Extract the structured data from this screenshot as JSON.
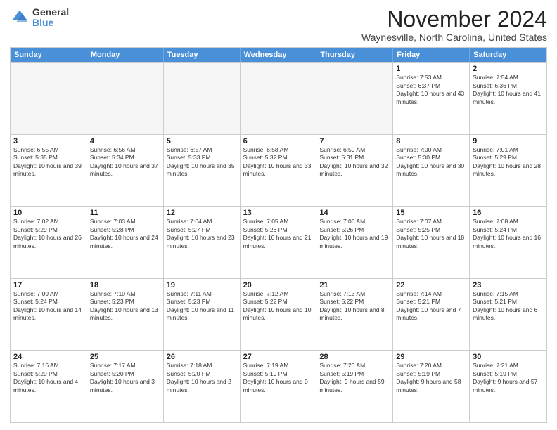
{
  "logo": {
    "general": "General",
    "blue": "Blue"
  },
  "header": {
    "month": "November 2024",
    "location": "Waynesville, North Carolina, United States"
  },
  "days": [
    "Sunday",
    "Monday",
    "Tuesday",
    "Wednesday",
    "Thursday",
    "Friday",
    "Saturday"
  ],
  "rows": [
    [
      {
        "day": "",
        "empty": true
      },
      {
        "day": "",
        "empty": true
      },
      {
        "day": "",
        "empty": true
      },
      {
        "day": "",
        "empty": true
      },
      {
        "day": "",
        "empty": true
      },
      {
        "day": "1",
        "rise": "Sunrise: 7:53 AM",
        "set": "Sunset: 6:37 PM",
        "daylight": "Daylight: 10 hours and 43 minutes."
      },
      {
        "day": "2",
        "rise": "Sunrise: 7:54 AM",
        "set": "Sunset: 6:36 PM",
        "daylight": "Daylight: 10 hours and 41 minutes."
      }
    ],
    [
      {
        "day": "3",
        "rise": "Sunrise: 6:55 AM",
        "set": "Sunset: 5:35 PM",
        "daylight": "Daylight: 10 hours and 39 minutes."
      },
      {
        "day": "4",
        "rise": "Sunrise: 6:56 AM",
        "set": "Sunset: 5:34 PM",
        "daylight": "Daylight: 10 hours and 37 minutes."
      },
      {
        "day": "5",
        "rise": "Sunrise: 6:57 AM",
        "set": "Sunset: 5:33 PM",
        "daylight": "Daylight: 10 hours and 35 minutes."
      },
      {
        "day": "6",
        "rise": "Sunrise: 6:58 AM",
        "set": "Sunset: 5:32 PM",
        "daylight": "Daylight: 10 hours and 33 minutes."
      },
      {
        "day": "7",
        "rise": "Sunrise: 6:59 AM",
        "set": "Sunset: 5:31 PM",
        "daylight": "Daylight: 10 hours and 32 minutes."
      },
      {
        "day": "8",
        "rise": "Sunrise: 7:00 AM",
        "set": "Sunset: 5:30 PM",
        "daylight": "Daylight: 10 hours and 30 minutes."
      },
      {
        "day": "9",
        "rise": "Sunrise: 7:01 AM",
        "set": "Sunset: 5:29 PM",
        "daylight": "Daylight: 10 hours and 28 minutes."
      }
    ],
    [
      {
        "day": "10",
        "rise": "Sunrise: 7:02 AM",
        "set": "Sunset: 5:29 PM",
        "daylight": "Daylight: 10 hours and 26 minutes."
      },
      {
        "day": "11",
        "rise": "Sunrise: 7:03 AM",
        "set": "Sunset: 5:28 PM",
        "daylight": "Daylight: 10 hours and 24 minutes."
      },
      {
        "day": "12",
        "rise": "Sunrise: 7:04 AM",
        "set": "Sunset: 5:27 PM",
        "daylight": "Daylight: 10 hours and 23 minutes."
      },
      {
        "day": "13",
        "rise": "Sunrise: 7:05 AM",
        "set": "Sunset: 5:26 PM",
        "daylight": "Daylight: 10 hours and 21 minutes."
      },
      {
        "day": "14",
        "rise": "Sunrise: 7:06 AM",
        "set": "Sunset: 5:26 PM",
        "daylight": "Daylight: 10 hours and 19 minutes."
      },
      {
        "day": "15",
        "rise": "Sunrise: 7:07 AM",
        "set": "Sunset: 5:25 PM",
        "daylight": "Daylight: 10 hours and 18 minutes."
      },
      {
        "day": "16",
        "rise": "Sunrise: 7:08 AM",
        "set": "Sunset: 5:24 PM",
        "daylight": "Daylight: 10 hours and 16 minutes."
      }
    ],
    [
      {
        "day": "17",
        "rise": "Sunrise: 7:09 AM",
        "set": "Sunset: 5:24 PM",
        "daylight": "Daylight: 10 hours and 14 minutes."
      },
      {
        "day": "18",
        "rise": "Sunrise: 7:10 AM",
        "set": "Sunset: 5:23 PM",
        "daylight": "Daylight: 10 hours and 13 minutes."
      },
      {
        "day": "19",
        "rise": "Sunrise: 7:11 AM",
        "set": "Sunset: 5:23 PM",
        "daylight": "Daylight: 10 hours and 11 minutes."
      },
      {
        "day": "20",
        "rise": "Sunrise: 7:12 AM",
        "set": "Sunset: 5:22 PM",
        "daylight": "Daylight: 10 hours and 10 minutes."
      },
      {
        "day": "21",
        "rise": "Sunrise: 7:13 AM",
        "set": "Sunset: 5:22 PM",
        "daylight": "Daylight: 10 hours and 8 minutes."
      },
      {
        "day": "22",
        "rise": "Sunrise: 7:14 AM",
        "set": "Sunset: 5:21 PM",
        "daylight": "Daylight: 10 hours and 7 minutes."
      },
      {
        "day": "23",
        "rise": "Sunrise: 7:15 AM",
        "set": "Sunset: 5:21 PM",
        "daylight": "Daylight: 10 hours and 6 minutes."
      }
    ],
    [
      {
        "day": "24",
        "rise": "Sunrise: 7:16 AM",
        "set": "Sunset: 5:20 PM",
        "daylight": "Daylight: 10 hours and 4 minutes."
      },
      {
        "day": "25",
        "rise": "Sunrise: 7:17 AM",
        "set": "Sunset: 5:20 PM",
        "daylight": "Daylight: 10 hours and 3 minutes."
      },
      {
        "day": "26",
        "rise": "Sunrise: 7:18 AM",
        "set": "Sunset: 5:20 PM",
        "daylight": "Daylight: 10 hours and 2 minutes."
      },
      {
        "day": "27",
        "rise": "Sunrise: 7:19 AM",
        "set": "Sunset: 5:19 PM",
        "daylight": "Daylight: 10 hours and 0 minutes."
      },
      {
        "day": "28",
        "rise": "Sunrise: 7:20 AM",
        "set": "Sunset: 5:19 PM",
        "daylight": "Daylight: 9 hours and 59 minutes."
      },
      {
        "day": "29",
        "rise": "Sunrise: 7:20 AM",
        "set": "Sunset: 5:19 PM",
        "daylight": "Daylight: 9 hours and 58 minutes."
      },
      {
        "day": "30",
        "rise": "Sunrise: 7:21 AM",
        "set": "Sunset: 5:19 PM",
        "daylight": "Daylight: 9 hours and 57 minutes."
      }
    ]
  ]
}
